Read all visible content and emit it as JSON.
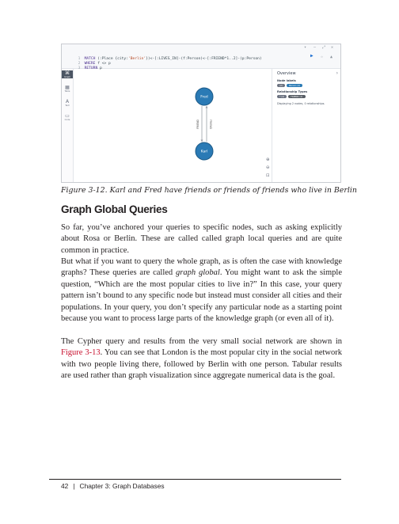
{
  "screenshot": {
    "query_lines": [
      {
        "num": "1",
        "pre": "MATCH ",
        "kw": "",
        "text": "(:Place {city:",
        "str": "'Berlin'",
        "post": "})<-[:LIVES_IN]-(f:Person)<-[:FRIEND*1..2]-(p:Person)"
      },
      {
        "num": "2",
        "pre": "WHERE ",
        "kw": "",
        "text": "f <> p",
        "str": "",
        "post": ""
      },
      {
        "num": "3",
        "pre": "RETURN ",
        "kw": "",
        "text": "p",
        "str": "",
        "post": ""
      }
    ],
    "sidebar": [
      {
        "label": "Graph",
        "icon": "graph-icon",
        "glyph": "⌘"
      },
      {
        "label": "Table",
        "icon": "table-icon",
        "glyph": "▦"
      },
      {
        "label": "Text",
        "icon": "text-icon",
        "glyph": "A"
      },
      {
        "label": "Code",
        "icon": "code-icon",
        "glyph": "▭"
      }
    ],
    "nodes": [
      {
        "label": "Fred"
      },
      {
        "label": "Karl"
      }
    ],
    "relationships": [
      {
        "label": "FRIEND"
      },
      {
        "label": "FRIEND"
      }
    ],
    "node_color": "#2a7ab5",
    "overview": {
      "title": "Overview",
      "node_labels_heading": "Node labels",
      "node_label_pills": [
        "(2)",
        "Person (2)"
      ],
      "relationship_types_heading": "Relationship Types",
      "relationship_pills": [
        "* (2)",
        "FRIEND (2)"
      ],
      "summary": "Displaying 2 nodes, 0 relationships."
    }
  },
  "caption": "Figure 3-12. Karl and Fred have friends or friends of friends who live in Berlin",
  "heading": "Graph Global Queries",
  "paragraphs": [
    {
      "parts": [
        {
          "text": "So far, you’ve anchored your queries to specific nodes, such as asking explicitly about Rosa or Berlin. These are called called graph local queries and are quite common in practice."
        }
      ]
    },
    {
      "parts": [
        {
          "text": "But what if you want to query the whole graph, as is often the case with knowledge graphs? These queries are called "
        },
        {
          "text": "graph global",
          "style": "italic"
        },
        {
          "text": ". You might want to ask the simple question, “Which are the most popular cities to live in?” In this case, your query pattern isn’t bound to any specific node but instead must consider all cities and their populations. In your query, you don’t specify any particular node as a starting point because you want to process large parts of the knowledge graph (or even all of it)."
        }
      ]
    },
    {
      "parts": [
        {
          "text": "The Cypher query and results from the very small social network are shown in "
        },
        {
          "text": "Figure 3-13",
          "style": "link"
        },
        {
          "text": ". You can see that London is the most popular city in the social network with two people living there, followed by Berlin with one person. Tabular results are used rather than graph visualization since aggregate numerical data is the goal."
        }
      ]
    }
  ],
  "footer": {
    "page_number": "42",
    "separator": "|",
    "chapter": "Chapter 3: Graph Databases"
  }
}
